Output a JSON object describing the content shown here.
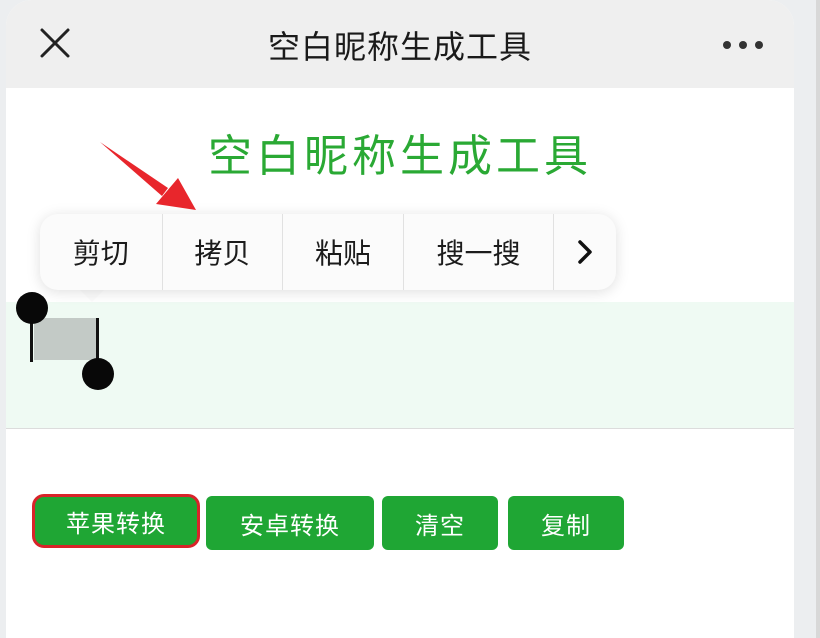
{
  "nav": {
    "title": "空白昵称生成工具",
    "close_icon": "close-icon",
    "more_icon": "more-icon"
  },
  "page": {
    "title": "空白昵称生成工具"
  },
  "context_menu": {
    "items": [
      "剪切",
      "拷贝",
      "粘贴",
      "搜一搜"
    ],
    "more_icon": "chevron-right-icon"
  },
  "buttons": {
    "apple": "苹果转换",
    "android": "安卓转换",
    "clear": "清空",
    "copy": "复制"
  },
  "colors": {
    "accent_green": "#2aa934",
    "button_green": "#1fa634",
    "highlight_red": "#d9232a",
    "input_bg": "#effaf3"
  }
}
